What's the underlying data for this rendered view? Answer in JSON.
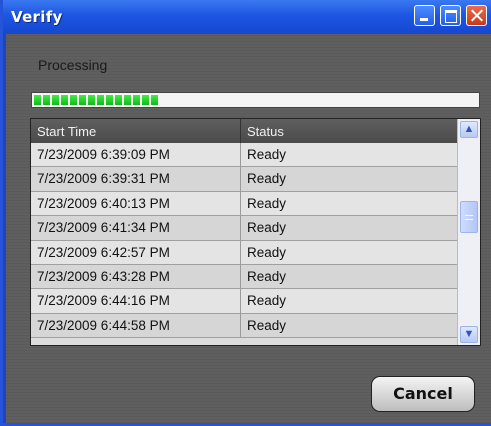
{
  "window": {
    "title": "Verify"
  },
  "status_label": "Processing",
  "progress": {
    "segments_filled": 14,
    "fraction": 0.31
  },
  "table": {
    "columns": [
      "Start Time",
      "Status"
    ],
    "rows": [
      [
        "7/23/2009 6:39:09 PM",
        "Ready"
      ],
      [
        "7/23/2009 6:39:31 PM",
        "Ready"
      ],
      [
        "7/23/2009 6:40:13 PM",
        "Ready"
      ],
      [
        "7/23/2009 6:41:34 PM",
        "Ready"
      ],
      [
        "7/23/2009 6:42:57 PM",
        "Ready"
      ],
      [
        "7/23/2009 6:43:28 PM",
        "Ready"
      ],
      [
        "7/23/2009 6:44:16 PM",
        "Ready"
      ],
      [
        "7/23/2009 6:44:58 PM",
        "Ready"
      ]
    ]
  },
  "buttons": {
    "cancel": "Cancel"
  },
  "colors": {
    "titlebar": "#1d56e2",
    "progress_fill": "#22cc26",
    "dialog_bg": "#5c5c5c"
  },
  "icons": {
    "minimize": "minimize-icon",
    "maximize": "maximize-icon",
    "close": "close-icon",
    "scroll_up": "scroll-up-icon",
    "scroll_down": "scroll-down-icon"
  }
}
